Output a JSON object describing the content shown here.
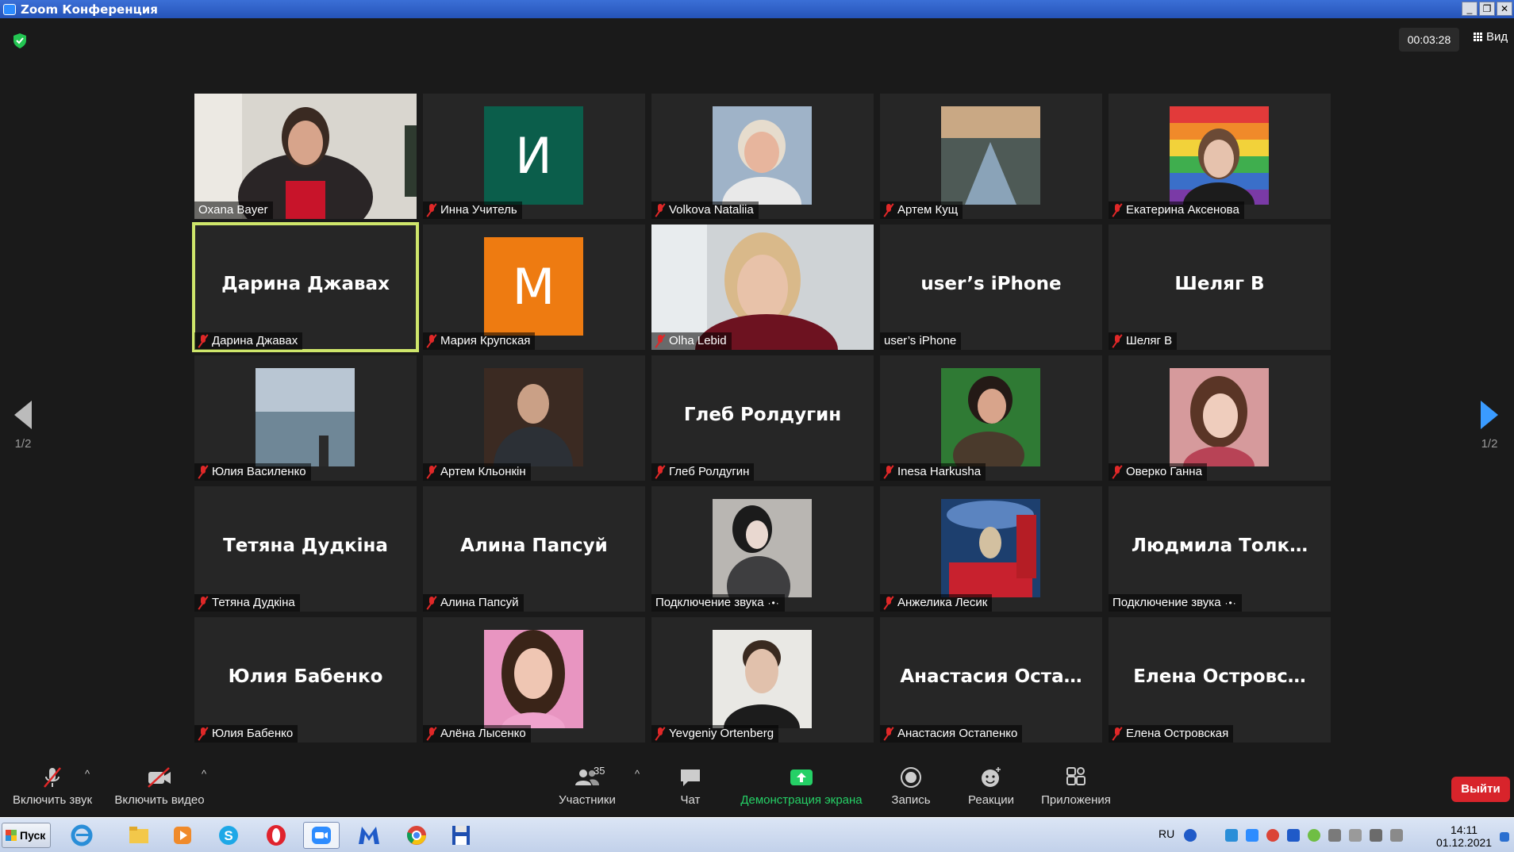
{
  "window": {
    "title": "Zoom Конференция",
    "btn_min": "_",
    "btn_max": "❐",
    "btn_close": "✕"
  },
  "top": {
    "timer": "00:03:28",
    "view_label": "Вид"
  },
  "pagination": {
    "left": "1/2",
    "right": "1/2"
  },
  "participants": [
    {
      "name": "Oxana Bayer",
      "big": "",
      "muted": false
    },
    {
      "name": "Инна Учитель",
      "big": "",
      "muted": true,
      "initial": "И"
    },
    {
      "name": "Volkova Nataliia",
      "big": "",
      "muted": true
    },
    {
      "name": "Артем Кущ",
      "big": "",
      "muted": true
    },
    {
      "name": "Екатерина Аксенова",
      "big": "",
      "muted": true
    },
    {
      "name": "Дарина Джавах",
      "big": "Дарина Джавах",
      "muted": true
    },
    {
      "name": "Мария Крупская",
      "big": "",
      "muted": true,
      "initial": "М"
    },
    {
      "name": "Olha Lebid",
      "big": "",
      "muted": true
    },
    {
      "name": "user’s iPhone",
      "big": "user’s iPhone",
      "muted": false
    },
    {
      "name": "Шеляг В",
      "big": "Шеляг В",
      "muted": true
    },
    {
      "name": "Юлия Василенко",
      "big": "",
      "muted": true
    },
    {
      "name": "Артем Кльонкін",
      "big": "",
      "muted": true
    },
    {
      "name": "Глеб Ролдугин",
      "big": "Глеб Ролдугин",
      "muted": true
    },
    {
      "name": "Inesa Harkusha",
      "big": "",
      "muted": true
    },
    {
      "name": "Оверко Ганна",
      "big": "",
      "muted": true
    },
    {
      "name": "Тетяна Дудкіна",
      "big": "Тетяна Дудкіна",
      "muted": true
    },
    {
      "name": "Алина Папсуй",
      "big": "Алина Папсуй",
      "muted": true
    },
    {
      "name": "Подключение звука",
      "big": "",
      "muted": false,
      "connecting": true
    },
    {
      "name": "Анжелика Лесик",
      "big": "",
      "muted": true
    },
    {
      "name": "Подключение звука",
      "big": "Людмила Толк…",
      "muted": false,
      "connecting": true
    },
    {
      "name": "Юлия Бабенко",
      "big": "Юлия Бабенко",
      "muted": true
    },
    {
      "name": "Алёна Лысенко",
      "big": "",
      "muted": true
    },
    {
      "name": "Yevgeniy Ortenberg",
      "big": "",
      "muted": true
    },
    {
      "name": "Анастасия Остапенко",
      "big": "Анастасия Оста…",
      "muted": true
    },
    {
      "name": "Елена Островская",
      "big": "Елена Островс…",
      "muted": true
    }
  ],
  "toolbar": {
    "unmute": "Включить звук",
    "start_video": "Включить видео",
    "participants": "Участники",
    "participants_count": "35",
    "chat": "Чат",
    "share": "Демонстрация экрана",
    "record": "Запись",
    "reactions": "Реакции",
    "apps": "Приложения",
    "leave": "Выйти"
  },
  "taskbar": {
    "start": "Пуск",
    "lang": "RU",
    "time": "14:11",
    "date": "01.12.2021"
  },
  "colors": {
    "active_speaker": "#cfe66b",
    "share_green": "#25d066",
    "leave_red": "#d8242b",
    "zoom_blue": "#2d8cff"
  }
}
